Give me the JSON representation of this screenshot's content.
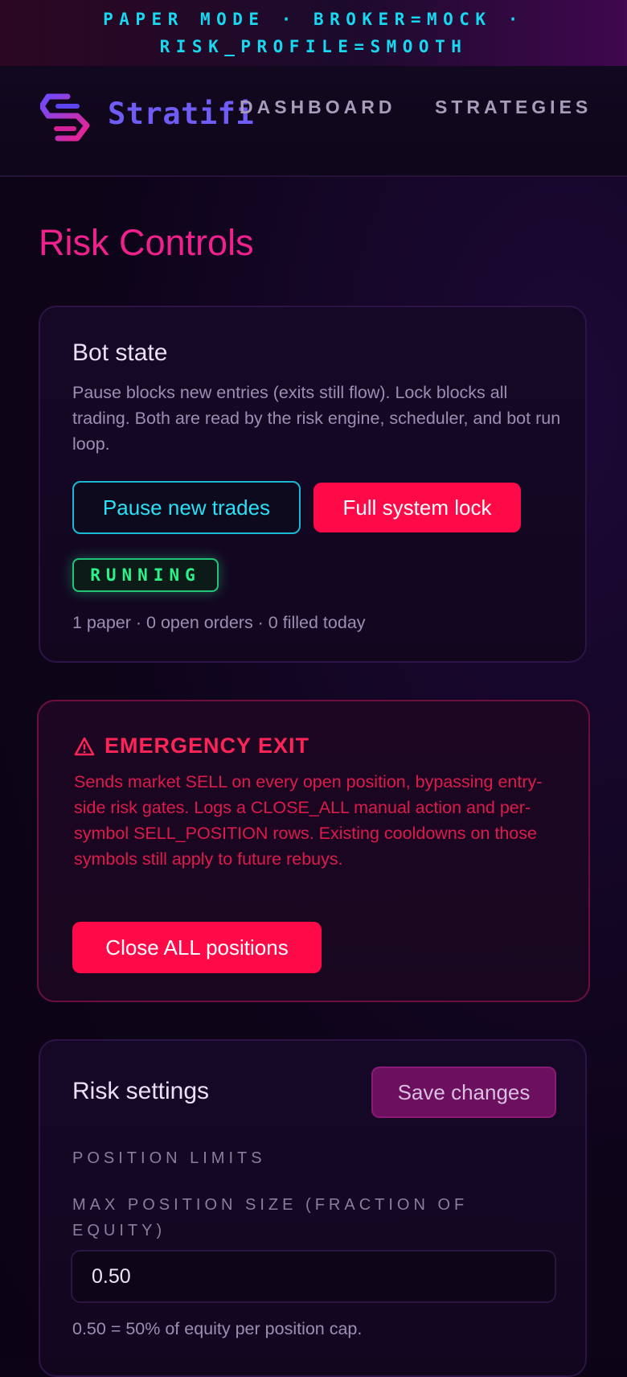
{
  "banner": {
    "line1": "PAPER MODE · BROKER=MOCK ·",
    "line2": "RISK_PROFILE=SMOOTH"
  },
  "nav": {
    "brand": "Stratifi",
    "links": [
      "DASHBOARD",
      "STRATEGIES"
    ]
  },
  "page": {
    "title": "Risk Controls"
  },
  "bot_state": {
    "title": "Bot state",
    "description": "Pause blocks new entries (exits still flow). Lock blocks all trading. Both are read by the risk engine, scheduler, and bot run loop.",
    "pause_label": "Pause new trades",
    "lock_label": "Full system lock",
    "status": "RUNNING",
    "stats": "1 paper · 0 open orders · 0 filled today"
  },
  "emergency": {
    "icon": "warning-icon",
    "title": "EMERGENCY EXIT",
    "description": "Sends market SELL on every open position, bypassing entry-side risk gates. Logs a CLOSE_ALL manual action and per-symbol SELL_POSITION rows. Existing cooldowns on those symbols still apply to future rebuys.",
    "close_all_label": "Close ALL positions"
  },
  "risk_settings": {
    "title": "Risk settings",
    "save_label": "Save changes",
    "section": "POSITION LIMITS",
    "max_position_label": "MAX POSITION SIZE (FRACTION OF EQUITY)",
    "max_position_value": "0.50",
    "max_position_hint": "0.50 = 50% of equity per position cap."
  },
  "colors": {
    "accent_pink": "#f0208c",
    "accent_cyan": "#19d7ee",
    "danger_red": "#ff0a48",
    "status_green": "#2cf28a",
    "brand_purple": "#6f5cf5"
  }
}
